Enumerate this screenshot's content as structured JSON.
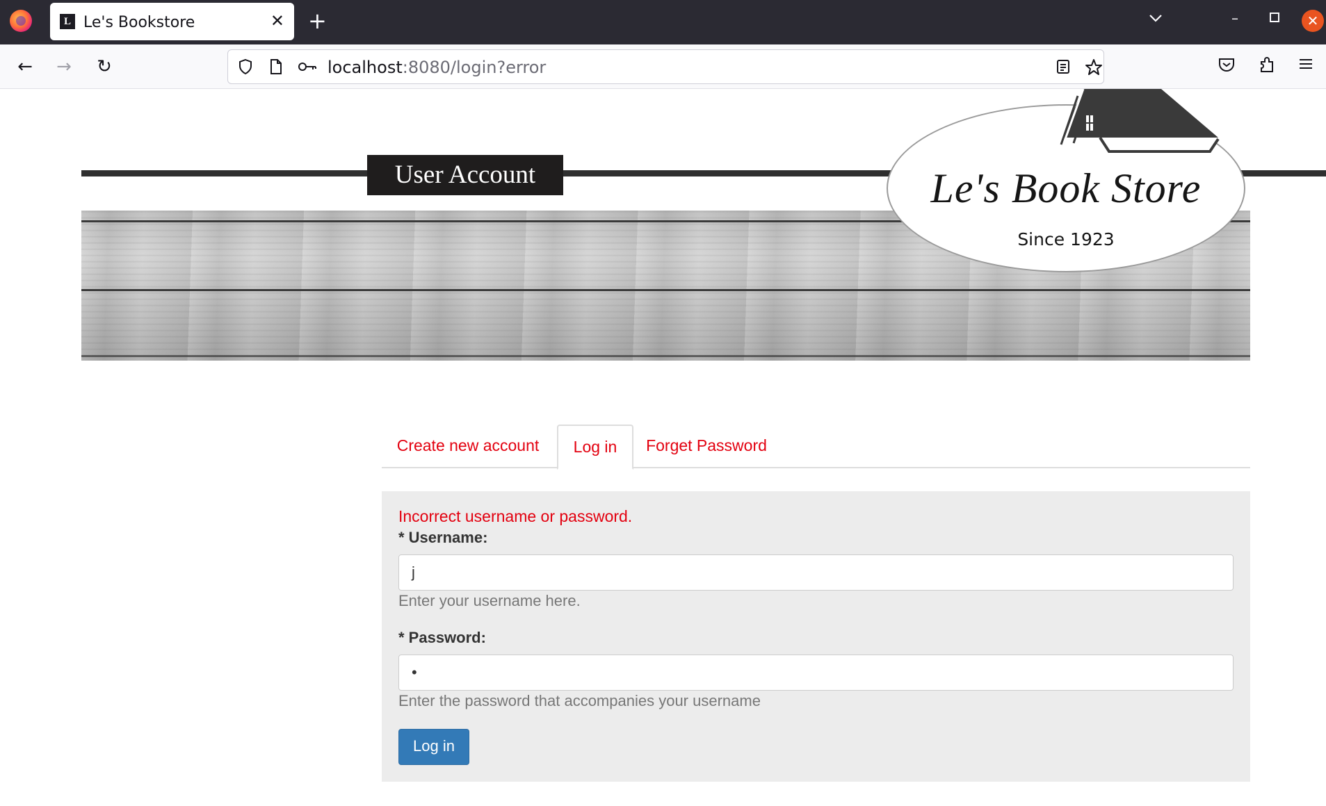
{
  "browser": {
    "tab_title": "Le's Bookstore",
    "tab_favicon_letter": "L",
    "url_host": "localhost",
    "url_rest": ":8080/login?error"
  },
  "header": {
    "page_title": "User Account",
    "logo_title": "Le's Book Store",
    "logo_since": "Since 1923"
  },
  "tabs": [
    {
      "label": "Create new account"
    },
    {
      "label": "Log in",
      "active": true
    },
    {
      "label": "Forget Password"
    }
  ],
  "form": {
    "error": "Incorrect username or password.",
    "username": {
      "label": "* Username:",
      "value": "j",
      "help": "Enter your username here."
    },
    "password": {
      "label": "* Password:",
      "value": "•",
      "help": "Enter the password that accompanies your username"
    },
    "submit_label": "Log in"
  },
  "colors": {
    "accent_red": "#e3000f",
    "button_blue": "#337ab7",
    "panel_gray": "#ececec",
    "title_box": "#1f1d1d"
  },
  "icons": [
    "firefox-logo",
    "close-icon",
    "plus-icon",
    "chevron-down-icon",
    "minimize-icon",
    "maximize-icon",
    "back-icon",
    "forward-icon",
    "reload-icon",
    "shield-icon",
    "page-icon",
    "key-icon",
    "reader-view-icon",
    "star-icon",
    "pocket-icon",
    "extensions-icon",
    "menu-icon"
  ]
}
